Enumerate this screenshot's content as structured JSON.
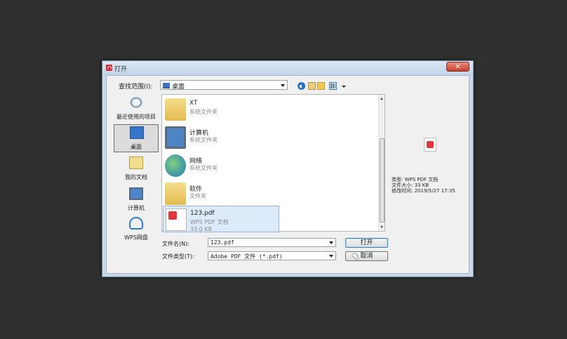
{
  "window": {
    "title": "打开",
    "close_glyph": "✕"
  },
  "lookin": {
    "label": "查找范围(I):",
    "value": "桌面"
  },
  "places": [
    {
      "label": "最近使用的项目",
      "icon": "recent-items-icon"
    },
    {
      "label": "桌面",
      "icon": "desktop-icon",
      "selected": true
    },
    {
      "label": "我的文档",
      "icon": "documents-icon"
    },
    {
      "label": "计算机",
      "icon": "computer-icon"
    },
    {
      "label": "WPS网盘",
      "icon": "cloud-drive-icon"
    }
  ],
  "files": [
    {
      "name": "XT",
      "type": "系统文件夹",
      "icon": "user-folder-icon"
    },
    {
      "name": "计算机",
      "type": "系统文件夹",
      "icon": "computer-icon"
    },
    {
      "name": "网络",
      "type": "系统文件夹",
      "icon": "network-icon"
    },
    {
      "name": "软件",
      "type": "文件夹",
      "icon": "folder-icon"
    },
    {
      "name": "123.pdf",
      "type": "WPS PDF 文档",
      "size": "33.0 KB",
      "icon": "pdf-file-icon",
      "selected": true
    }
  ],
  "filename": {
    "label": "文件名(N):",
    "value": "123.pdf"
  },
  "filetype": {
    "label": "文件类型(T):",
    "value": "Adobe PDF 文件 (*.pdf)"
  },
  "buttons": {
    "open": "打开",
    "cancel": "取消"
  },
  "preview": {
    "icon": "pdf-file-icon",
    "type_line": "类型: WPS PDF 文档",
    "size_line": "文件大小: 33 KB",
    "modified_line": "修改时间: 2019/5/27 17:35"
  }
}
